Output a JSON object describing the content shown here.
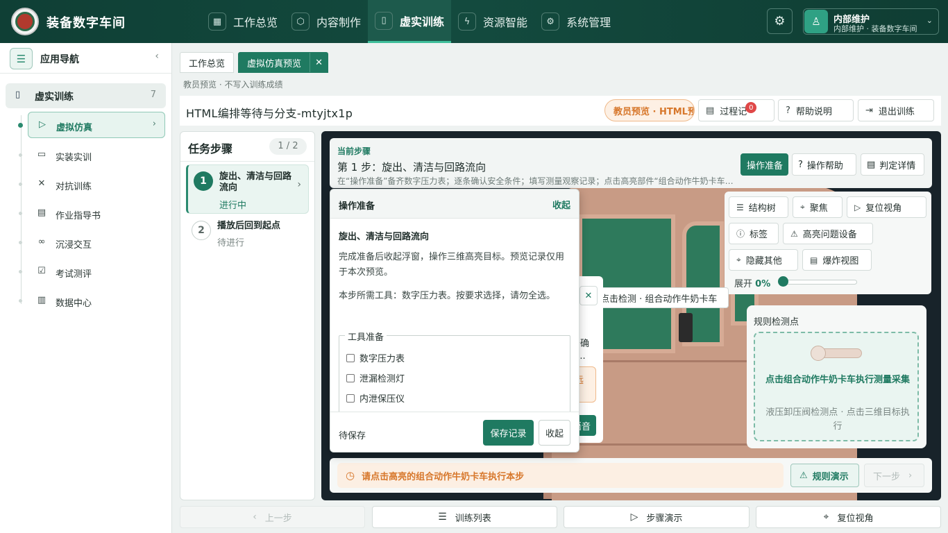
{
  "app": {
    "title": "装备数字车间"
  },
  "topnav": [
    {
      "label": "工作总览",
      "icon": "grid-icon"
    },
    {
      "label": "内容制作",
      "icon": "cube-icon"
    },
    {
      "label": "虚实训练",
      "icon": "book-icon",
      "active": true
    },
    {
      "label": "资源智能",
      "icon": "plug-icon"
    },
    {
      "label": "系统管理",
      "icon": "gear-icon"
    }
  ],
  "user": {
    "name": "内部维护",
    "sub": "内部维护 · 装备数字车间"
  },
  "sidebar": {
    "title": "应用导航",
    "group": {
      "label": "虚实训练",
      "count": "7"
    },
    "items": [
      {
        "label": "虚拟仿真",
        "icon": "play-circle-icon",
        "active": true
      },
      {
        "label": "实装实训",
        "icon": "monitor-icon"
      },
      {
        "label": "对抗训练",
        "icon": "swords-icon"
      },
      {
        "label": "作业指导书",
        "icon": "document-icon"
      },
      {
        "label": "沉浸交互",
        "icon": "vr-headset-icon"
      },
      {
        "label": "考试测评",
        "icon": "clipboard-check-icon"
      },
      {
        "label": "数据中心",
        "icon": "bar-chart-icon"
      }
    ]
  },
  "tabs": [
    {
      "label": "工作总览"
    },
    {
      "label": "虚拟仿真预览",
      "active": true
    }
  ],
  "subtitle": "教员预览 · 不写入训练成绩",
  "header": {
    "sim_title": "HTML编排等待与分支-mtyjtx1p",
    "preview_badge": "教员预览 · HTML预览",
    "process_label": "过程记",
    "process_count": "0",
    "help_label": "帮助说明",
    "exit_label": "退出训练"
  },
  "steps": {
    "title": "任务步骤",
    "count": "1 / 2",
    "list": [
      {
        "num": "1",
        "name": "旋出、清洁与回路流向",
        "status": "进行中",
        "active": true
      },
      {
        "num": "2",
        "name": "播放后回到起点",
        "status": "待进行",
        "active": false
      }
    ]
  },
  "current_step": {
    "label": "当前步骤",
    "title": "第 1 步：旋出、清洁与回路流向",
    "desc": "在“操作准备”备齐数字压力表；逐条确认安全条件；填写测量观察记录；点击高亮部件“组合动作牛奶卡车”执行",
    "prep_btn": "操作准备",
    "help_btn": "操作帮助",
    "judge_btn": "判定详情"
  },
  "tools": {
    "tree": "结构树",
    "focus": "聚焦",
    "reset_view": "复位视角",
    "label": "标签",
    "highlight": "高亮问题设备",
    "hide_others": "隐藏其他",
    "explode": "爆炸视图",
    "expand_label": "展开",
    "expand_value": "0%",
    "expand_fraction": 0
  },
  "detect_banner": "点击检测 · 组合动作牛奶卡车",
  "hidden_card": {
    "line1": "条确",
    "line2": "5...",
    "warn": "远",
    "button": "语音"
  },
  "rule": {
    "title": "规则检测点",
    "main": "点击组合动作牛奶卡车执行测量采集",
    "sub": "液压卸压阀检测点 · 点击三维目标执行"
  },
  "hint": {
    "text": "请点击高亮的组合动作牛奶卡车执行本步",
    "demo_btn": "规则演示",
    "next_btn": "下一步"
  },
  "prep": {
    "title": "操作准备",
    "collapse": "收起",
    "step_title": "旋出、清洁与回路流向",
    "p1": "完成准备后收起浮窗，操作三维高亮目标。预览记录仅用于本次预览。",
    "p2": "本步所需工具：数字压力表。按要求选择，请勿全选。",
    "legend": "工具准备",
    "tools": [
      "数字压力表",
      "泄漏检测灯",
      "内泄保压仪"
    ],
    "status": "待保存",
    "save_btn": "保存记录",
    "close_btn": "收起"
  },
  "bottom": {
    "prev": "上一步",
    "list": "训练列表",
    "demo": "步骤演示",
    "reset": "复位视角"
  },
  "colors": {
    "brand": "#134a3e",
    "accent": "#1f7a61",
    "warning": "#d7772b"
  }
}
